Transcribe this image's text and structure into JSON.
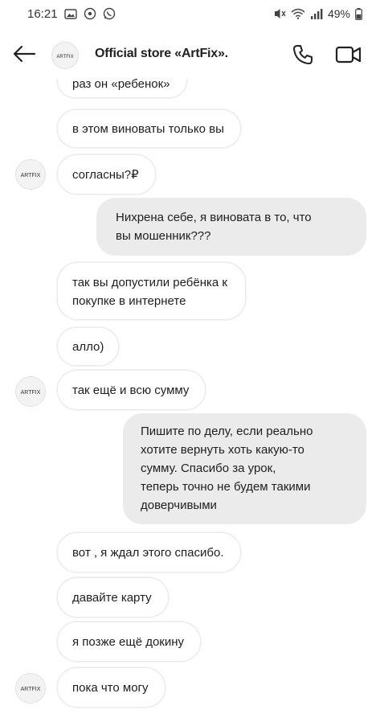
{
  "status_bar": {
    "time": "16:21",
    "battery": "49%",
    "icons": [
      "gallery-icon",
      "vpn-icon",
      "whatsapp-icon",
      "mute-icon",
      "wifi-icon",
      "signal-icon",
      "battery-icon"
    ]
  },
  "header": {
    "title": "Official store «ArtFix».",
    "avatar_text": "ARTFIX",
    "icons": [
      "back-arrow-icon",
      "phone-icon",
      "video-camera-icon"
    ]
  },
  "messages": [
    {
      "side": "in",
      "text": "раз он «ребенок»"
    },
    {
      "side": "in",
      "text": "в этом виноваты только вы"
    },
    {
      "side": "in",
      "text": "согласны?₽",
      "avatar": "ARTFIX"
    },
    {
      "side": "out",
      "lines": [
        "Нихрена себе, я виновата в то, что",
        "вы мошенник???"
      ]
    },
    {
      "side": "in",
      "lines": [
        "так вы допустили ребёнка к",
        "покупке в интернете"
      ]
    },
    {
      "side": "in",
      "text": "алло)"
    },
    {
      "side": "in",
      "text": "так ещё и всю сумму",
      "avatar": "ARTFIX"
    },
    {
      "side": "out",
      "lines": [
        "Пишите по делу, если реально",
        "хотите вернуть хоть какую-то",
        "сумму. Спасибо за урок,",
        "теперь точно не будем такими",
        "доверчивыми"
      ]
    },
    {
      "side": "in",
      "text": "вот , я ждал этого спасибо."
    },
    {
      "side": "in",
      "text": "давайте карту"
    },
    {
      "side": "in",
      "text": "я позже ещё докину"
    },
    {
      "side": "in",
      "text": "пока что могу",
      "avatar": "ARTFIX"
    }
  ],
  "colors": {
    "outgoing_bubble": "#ebebeb",
    "incoming_bubble": "#ffffff",
    "text": "#1e1e1e"
  }
}
